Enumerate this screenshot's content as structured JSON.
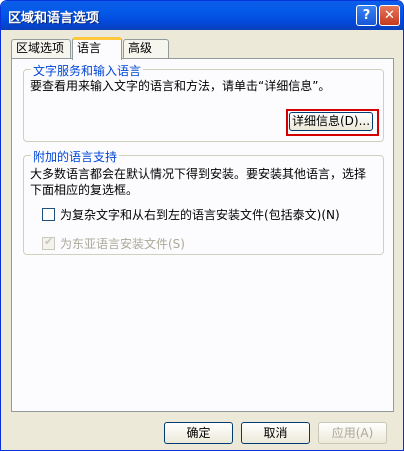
{
  "window": {
    "title": "区域和语言选项",
    "help_label": "?",
    "close_label": "✕"
  },
  "tabs": [
    {
      "label": "区域选项"
    },
    {
      "label": "语言"
    },
    {
      "label": "高级"
    }
  ],
  "text_services": {
    "group_label": "文字服务和输入语言",
    "description": "要查看用来输入文字的语言和方法，请单击“详细信息”。",
    "details_button": "详细信息(D)..."
  },
  "supplemental": {
    "group_label": "附加的语言支持",
    "description_line1": "大多数语言都会在默认情况下得到安装。要安装其他语言，选择",
    "description_line2": "下面相应的复选框。",
    "complex_script_label": "为复杂文字和从右到左的语言安装文件(包括泰文)(N)",
    "east_asian_label": "为东亚语言安装文件(S)"
  },
  "footer": {
    "ok": "确定",
    "cancel": "取消",
    "apply": "应用(A)"
  }
}
